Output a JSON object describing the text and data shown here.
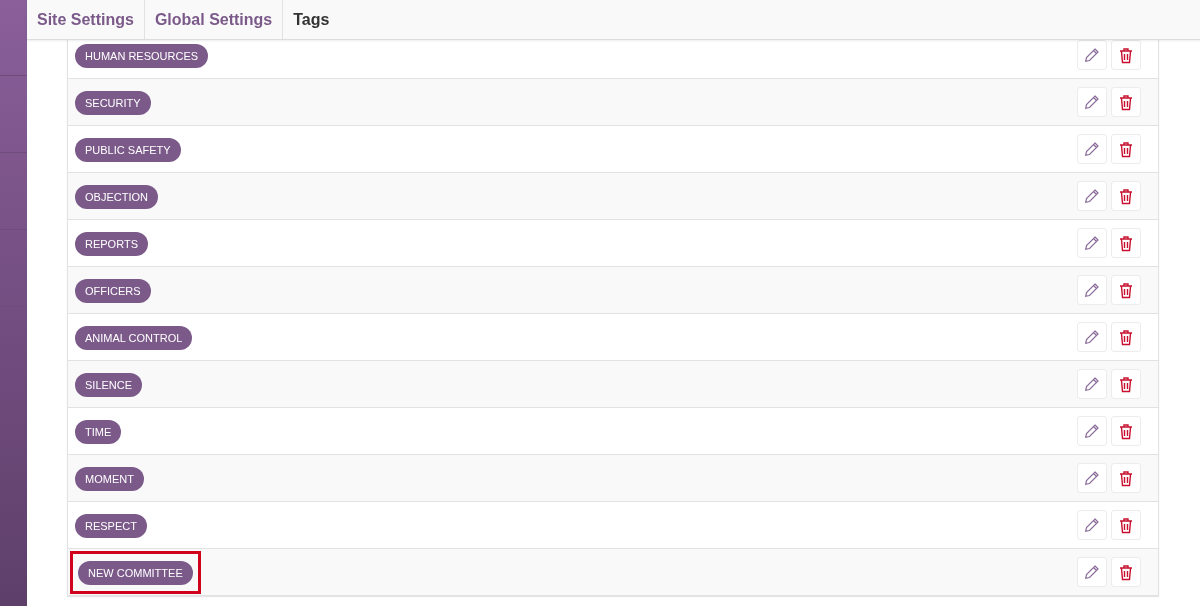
{
  "tabs": [
    {
      "label": "Site Settings",
      "selected": false
    },
    {
      "label": "Global Settings",
      "selected": false
    },
    {
      "label": "Tags",
      "selected": true
    }
  ],
  "tags": [
    {
      "label": "HUMAN RESOURCES",
      "highlighted": false
    },
    {
      "label": "SECURITY",
      "highlighted": false
    },
    {
      "label": "PUBLIC SAFETY",
      "highlighted": false
    },
    {
      "label": "OBJECTION",
      "highlighted": false
    },
    {
      "label": "REPORTS",
      "highlighted": false
    },
    {
      "label": "OFFICERS",
      "highlighted": false
    },
    {
      "label": "ANIMAL CONTROL",
      "highlighted": false
    },
    {
      "label": "SILENCE",
      "highlighted": false
    },
    {
      "label": "TIME",
      "highlighted": false
    },
    {
      "label": "MOMENT",
      "highlighted": false
    },
    {
      "label": "RESPECT",
      "highlighted": false
    },
    {
      "label": "NEW COMMITTEE",
      "highlighted": true
    }
  ]
}
